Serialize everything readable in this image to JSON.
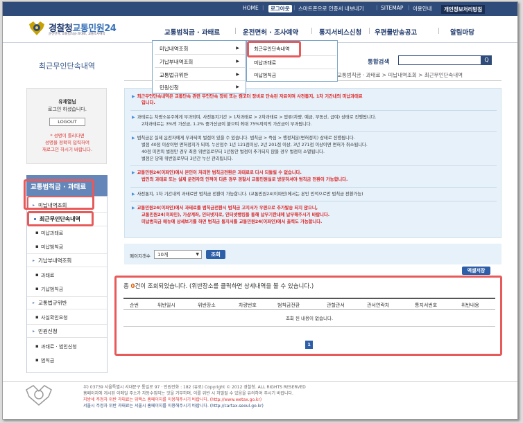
{
  "topnav": {
    "home": "HOME",
    "logout": "로그아웃",
    "phone_auth": "스마트폰으로 인증서 내보내기",
    "sitemap": "SITEMAP",
    "guide": "이용안내",
    "gov": "개인정보처리방침"
  },
  "logo": {
    "part1": "경찰청",
    "part2": "교통민원24",
    "sub": "운전면허, 교통범칙금·과태료, 교통조사예약"
  },
  "gnb": {
    "item1": "교통범칙금 · 과태료",
    "item2": "운전면허 · 조사예약",
    "item3": "통지서비스신청",
    "item4": "우편물반송공고",
    "item5": "알림마당"
  },
  "dropdown1": {
    "i1": "미납내역조회",
    "i2": "기납부내역조회",
    "i3": "교통법규위반",
    "i4": "민원신청",
    "arrow": "▶"
  },
  "dropdown2": {
    "i1": "최근무인단속내역",
    "i2": "미납과태료",
    "i3": "미납범칙금"
  },
  "page_title": "최근무인단속내역",
  "search": {
    "label": "통합검색",
    "btn": "Q"
  },
  "breadcrumb": "교통범칙금 · 과태료 > 미납내역조회 > 최근무인단속내역",
  "login": {
    "name": "유재열님",
    "msg": "로그인 하셨습니다.",
    "btn": "LOGOUT",
    "w1": "* 성명이 틀리다면",
    "w2": "성명을 정확히 입력하여",
    "w3": "재로그인 하시기 바랍니다."
  },
  "lnb": {
    "head": "교통범칙금 · 과태료",
    "m1": "미납내역조회",
    "m1s1": "최근무인단속내역",
    "m1s2": "미납과태료",
    "m1s3": "미납범칙금",
    "m2": "기납부내역조회",
    "m2s1": "과태료",
    "m2s2": "기납범칙금",
    "m3": "교통법규위반",
    "m3s1": "사실확인요청",
    "m4": "민원신청",
    "m4s1": "과태료 · 범인신청",
    "m4s2": "범칙금"
  },
  "notice": {
    "n1a": "최근무인단속내역은 교통단속 관련 무인단속 장비 또는 캠코더 장비로 단속된 자료이며 사전통지, 1차 기간내의 미납과태료",
    "n1b": "입니다.",
    "n2a": "과태료는 차량소유주에게 부과되며, 사전통지기간 > 1차과태료 > 2차과태료 > 압류(차량, 예금, 부동산, 급여) 상태로 진행됩니다.",
    "n2b": "2차과태료는 3%의 가산금, 1.2% 중가산금이 붙으며 최대 75%까지의 가산금이 부과됩니다.",
    "n3a": "범칙금은 실제 운전자에게 부과되며 벌점이 있을 수 있습니다. 범칙금 > 즉심 > 행정처분(면허정지) 상태로 진행됩니다.",
    "n3b": "벌점 40점 이상이면 면허정지가 되며, 누산점수 1년 121점이상, 2년 201점 이상, 3년 271점 이상이면 면허가 취소됩니다.",
    "n3c": "40점 미만의 벌점만 경우 최종 위반일로부터 1년동안 벌점이 추가되지 않을 경우 벌점이 소멸됩니다.",
    "n3d": "벌점은 당해 위반일로부터 3년간 누산 관리됩니다.",
    "n4a": "교통민원24(이파인)에서 본인이 처리한 범칙금전환은 과태료로 다시 되돌릴 수 없습니다.",
    "n4b": "법인의 과태료 또는 실제 운전자의 인적이 다른 경우 경찰서 교통민원실로 방문하셔야 범칙금 전환이 가능합니다.",
    "n5": "사전통지, 1차 기간내의 과태료만 범칙금 전환이 가능합니다. (교통민원24(이파인)에서는 본인 인적으로만 범칙금 전환가능)",
    "n6a": "교통민원24(이파인)에서 과태료를 범칙금전환시 범칙금 고지서가 우편으로 추가발송 되지 않으니,",
    "n6b": "교통민원24(이파인), 가상계좌, 인터넷지로, 인터넷뱅킹을 통해 납부기한내에 납부해주시기 바랍니다.",
    "n6c": "미납범칙금 메뉴에 상세보기를 하면 범칙금 통지서를 교통민원24(이파인)에서 출력도 가능합니다.",
    "tri": "▶"
  },
  "filter": {
    "label": "페이지갯수",
    "value": "10개",
    "btn": "조회"
  },
  "excel": "엑셀저장",
  "result": {
    "pre": "총 ",
    "count": "0",
    "post": "건이 조회되었습니다. (위반장소를 클릭하면 상세내역을 볼 수 있습니다.)"
  },
  "table": {
    "c1": "순번",
    "c2": "위반일시",
    "c3": "위반장소",
    "c4": "차량번호",
    "c5": "범칙금전환",
    "c6": "관할관서",
    "c7": "관서연락처",
    "c8": "통지서번호",
    "c9": "위반내용",
    "empty": "조회 된 내용이 없습니다."
  },
  "pagination": "1",
  "footer": {
    "l1": "우) 03739 서울특별시 서대문구 통일로 97 · 민원전화 : 182 (유료)          Copyright © 2012 경찰청. ALL RIGHTS RESERVED",
    "l2": "홈페이지에 게시된 이메일 주소가 자동수집되는 것을 거부하며, 이를 위반 시 처벌될 수 있음을 유의하여 주시기 바랍니다.",
    "l3": "지방세 주정차 위반 과태료는 위택스 홈페이지를 이용해주시기 바랍니다. (http://www.wetax.go.kr)",
    "l4": "서울시 주정차 위반 과태료는 서울시 홈페이지를 이용해주시기 바랍니다. (http://cartax.seoul.go.kr)"
  },
  "colors": {
    "navy": "#2f4b7a",
    "accent": "#2d5ea8",
    "highlight": "#e85a5a",
    "notice_bg": "#e6f1fa"
  }
}
